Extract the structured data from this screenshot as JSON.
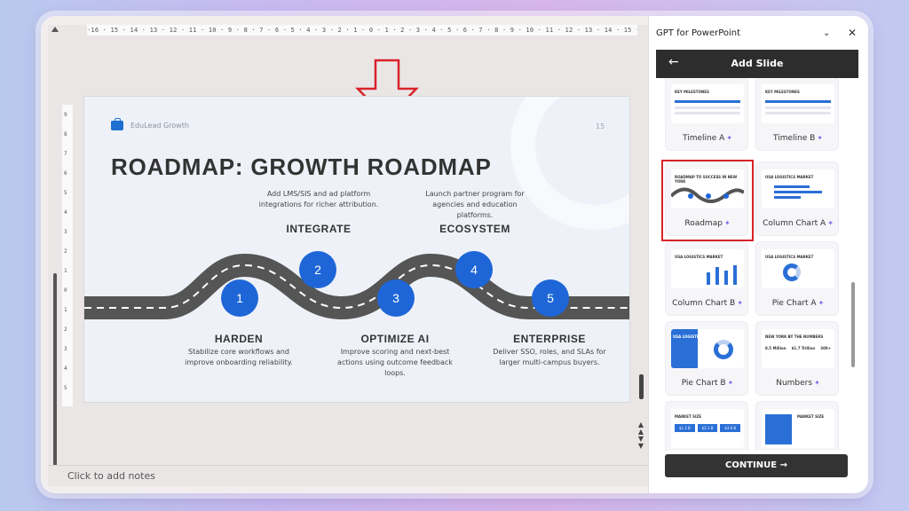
{
  "editor": {
    "ruler_text": "·16 · 15 · 14 · 13 · 12 · 11 · 10 · 9 · 8 · 7 · 6 · 5 · 4 · 3 · 2 · 1 · 0 · 1 · 2 · 3 · 4 · 5 · 6 · 7 · 8 · 9 · 10 · 11 · 12 · 13 · 14 · 15 · 16",
    "notes_placeholder": "Click to add notes"
  },
  "slide": {
    "brand": "EduLead Growth",
    "page_number": "15",
    "title": "ROADMAP: GROWTH ROADMAP",
    "stages": [
      {
        "number": "1",
        "title": "HARDEN",
        "desc": "Stabilize core workflows and improve onboarding reliability."
      },
      {
        "number": "2",
        "title": "INTEGRATE",
        "desc": "Add LMS/SIS and ad platform integrations for richer attribution."
      },
      {
        "number": "3",
        "title": "OPTIMIZE AI",
        "desc": "Improve scoring and next-best actions using outcome feedback loops."
      },
      {
        "number": "4",
        "title": "ECOSYSTEM",
        "desc": "Launch partner program for agencies and education platforms."
      },
      {
        "number": "5",
        "title": "ENTERPRISE",
        "desc": "Deliver SSO, roles, and SLAs for larger multi-campus buyers."
      }
    ]
  },
  "panel": {
    "header": "GPT for PowerPoint",
    "bar_title": "Add Slide",
    "continue_label": "CONTINUE",
    "templates": [
      {
        "label": "Timeline A",
        "thumb_title": "KEY MILESTONES"
      },
      {
        "label": "Timeline B",
        "thumb_title": "KEY MILESTONES"
      },
      {
        "label": "Roadmap",
        "thumb_title": "ROADMAP TO SUCCESS IN NEW YORK"
      },
      {
        "label": "Column Chart A",
        "thumb_title": "USA LOGISTICS MARKET"
      },
      {
        "label": "Column Chart B",
        "thumb_title": "USA LOGISTICS MARKET"
      },
      {
        "label": "Pie Chart A",
        "thumb_title": "USA LOGISTICS MARKET"
      },
      {
        "label": "Pie Chart B",
        "thumb_title": "USA LOGISTICS MARKET"
      },
      {
        "label": "Numbers",
        "thumb_title": "NEW YORK BY THE NUMBERS"
      },
      {
        "label": "",
        "thumb_title": "MARKET SIZE"
      },
      {
        "label": "",
        "thumb_title": "MARKET SIZE"
      }
    ],
    "numbers_thumb": [
      "8.5 Million",
      "$1.7 Trillion",
      "300+"
    ],
    "market_thumb": [
      "$1.2 B",
      "$2.1 B",
      "$3.6 B"
    ]
  },
  "colors": {
    "accent": "#1e66d8",
    "selection": "#d8232a",
    "road": "#555555"
  },
  "icons": [
    "down-arrow-icon",
    "briefcase-icon",
    "back-arrow-icon",
    "chevron-down-icon",
    "close-icon",
    "sparkle-icon",
    "arrow-right-icon"
  ]
}
